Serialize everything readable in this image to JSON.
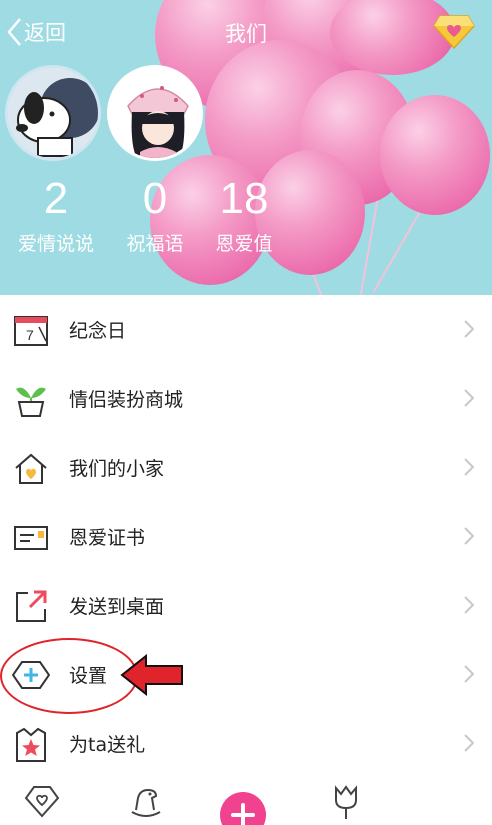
{
  "header": {
    "back_label": "返回",
    "title": "我们"
  },
  "stats": [
    {
      "value": "2",
      "label": "爱情说说"
    },
    {
      "value": "0",
      "label": "祝福语"
    },
    {
      "value": "18",
      "label": "恩爱值"
    }
  ],
  "menu": {
    "items": [
      {
        "label": "纪念日",
        "icon": "calendar-icon",
        "calendar_day": "7"
      },
      {
        "label": "情侣装扮商城",
        "icon": "sprout-pot-icon"
      },
      {
        "label": "我们的小家",
        "icon": "house-heart-icon"
      },
      {
        "label": "恩爱证书",
        "icon": "certificate-icon"
      },
      {
        "label": "发送到桌面",
        "icon": "send-to-desktop-icon"
      },
      {
        "label": "设置",
        "icon": "settings-hexagon-icon"
      },
      {
        "label": "为ta送礼",
        "icon": "gift-star-icon"
      }
    ]
  },
  "tabbar": {
    "tabs": [
      "heart-shield-icon",
      "rocking-horse-icon",
      "plus-icon",
      "tulip-icon"
    ]
  },
  "colors": {
    "hero_bg": "#9fdbe3",
    "balloon": "#ec6fae",
    "accent_pink": "#f0428e",
    "annotation_red": "#e0242b",
    "chevron": "#c8c8c8"
  }
}
